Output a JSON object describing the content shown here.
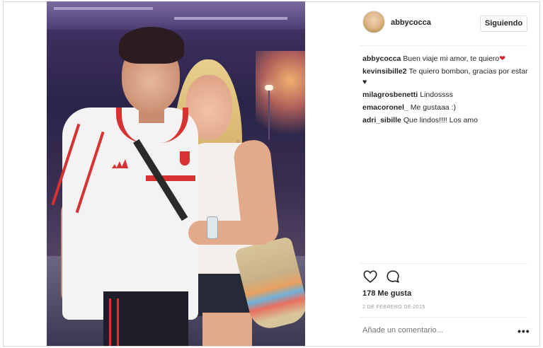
{
  "post": {
    "username": "abbycocca",
    "follow_label": "Siguiendo",
    "caption": {
      "user": "abbycocca",
      "text": "Buen viaje mi amor, te quiero",
      "emoji": "❤"
    },
    "comments": [
      {
        "user": "kevinsibille2",
        "text": "Te quiero bombon, gracias por estar ♥"
      },
      {
        "user": "milagrosbenetti",
        "text": "Lindossss"
      },
      {
        "user": "emacoronel_",
        "text": "Me gustaaa :)"
      },
      {
        "user": "adri_sibille",
        "text": "Que lindos!!!! Los amo"
      }
    ],
    "likes": "178 Me gusta",
    "date": "2 DE FEBRERO DE 2015",
    "comment_placeholder": "Añade un comentario...",
    "more_label": "•••"
  },
  "icons": {
    "like": "heart-outline-icon",
    "comment": "speech-bubble-icon",
    "more": "more-dots-icon"
  },
  "colors": {
    "brand_red": "#d63232",
    "text": "#262626",
    "muted": "#999999",
    "border": "#dbdbdb"
  }
}
